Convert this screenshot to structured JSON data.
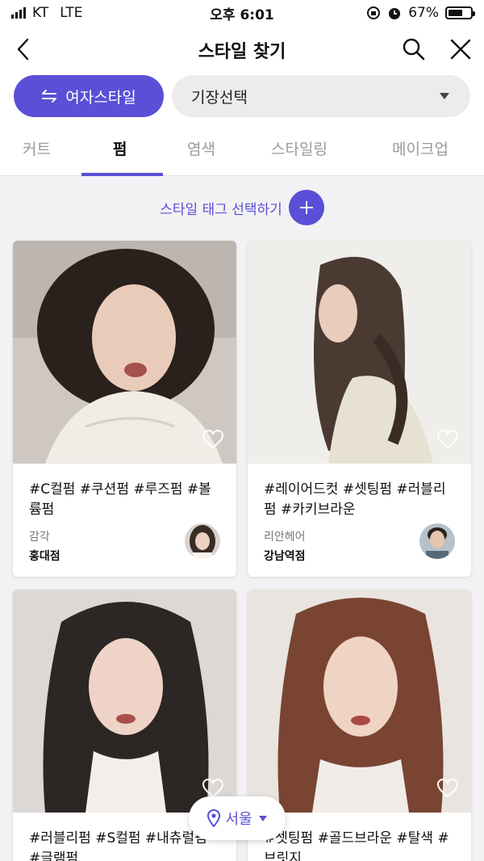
{
  "status_bar": {
    "carrier": "KT",
    "network": "LTE",
    "time": "오후 6:01",
    "battery": "67%",
    "battery_level": 0.67
  },
  "header": {
    "title": "스타일 찾기"
  },
  "filters": {
    "gender_label": "여자스타일",
    "length_label": "기장선택"
  },
  "tabs": [
    {
      "label": "커트",
      "active": false
    },
    {
      "label": "펌",
      "active": true
    },
    {
      "label": "염색",
      "active": false
    },
    {
      "label": "스타일링",
      "active": false
    },
    {
      "label": "메이크업",
      "active": false
    }
  ],
  "tag_select": {
    "label": "스타일 태그 선택하기"
  },
  "cards": [
    {
      "tags": "#C컬펌 #쿠션펌 #루즈펌 #볼륨펌",
      "salon": "감각",
      "branch": "홍대점"
    },
    {
      "tags": "#레이어드컷 #셋팅펌 #러블리펌 #카키브라운",
      "salon": "리안헤어",
      "branch": "강남역점"
    },
    {
      "tags": "#러블리펌 #S컬펌 #내츄럴펌 #글램펌",
      "salon": "",
      "branch": ""
    },
    {
      "tags": "#셋팅펌 #골드브라운 #탈색 #브릿지",
      "salon": "",
      "branch": ""
    }
  ],
  "region_button": {
    "label": "서울"
  },
  "colors": {
    "accent": "#5a4fd6",
    "background": "#f2f2f4",
    "chip": "#ececee"
  }
}
